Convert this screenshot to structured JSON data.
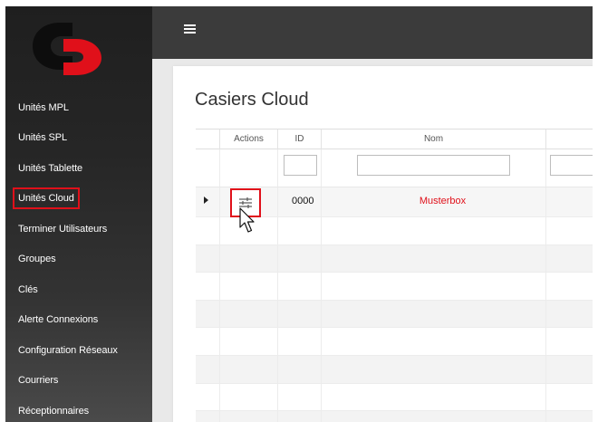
{
  "sidebar": {
    "items": [
      {
        "label": "Unités MPL",
        "active": false
      },
      {
        "label": "Unités SPL",
        "active": false
      },
      {
        "label": "Unités Tablette",
        "active": false
      },
      {
        "label": "Unités Cloud",
        "active": true
      },
      {
        "label": "Terminer Utilisateurs",
        "active": false
      },
      {
        "label": "Groupes",
        "active": false
      },
      {
        "label": "Clés",
        "active": false
      },
      {
        "label": "Alerte Connexions",
        "active": false
      },
      {
        "label": "Configuration Réseaux",
        "active": false
      },
      {
        "label": "Courriers",
        "active": false
      },
      {
        "label": "Réceptionnaires",
        "active": false
      }
    ]
  },
  "topbar": {
    "menu_icon": "hamburger-icon"
  },
  "main": {
    "title": "Casiers Cloud",
    "table": {
      "columns": [
        "Actions",
        "ID",
        "Nom"
      ],
      "rows": [
        {
          "id": "0000",
          "nom": "Musterbox",
          "action_icon": "sliders-icon"
        }
      ]
    }
  },
  "colors": {
    "accent": "#e0101a",
    "sidebar_bg": "#262626",
    "topbar_bg": "#3b3b3b",
    "content_bg": "#e9e9e9"
  }
}
